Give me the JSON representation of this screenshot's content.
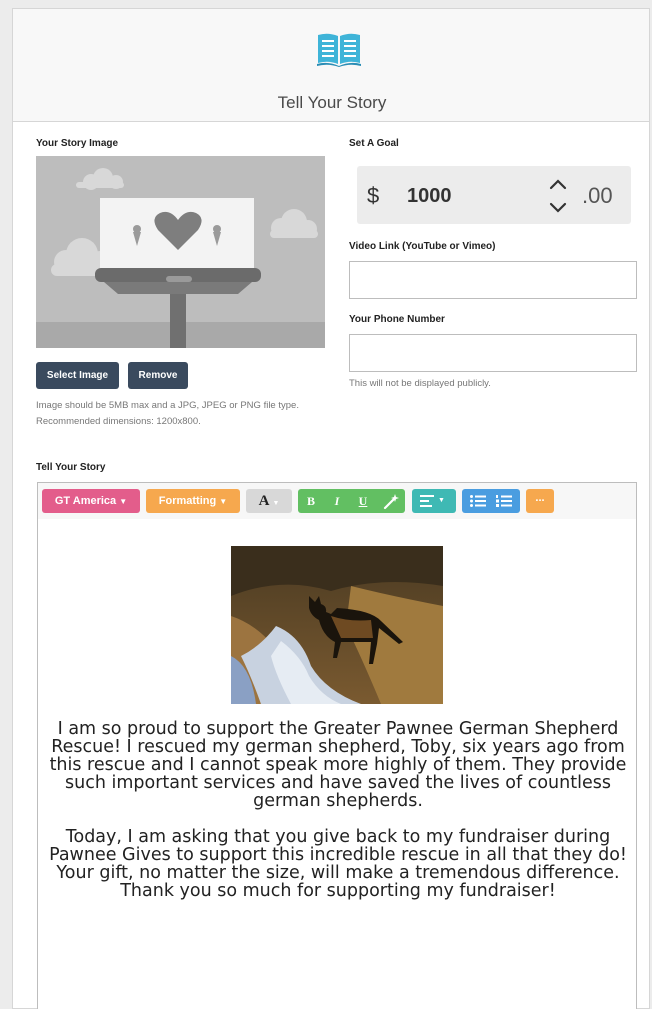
{
  "header": {
    "title": "Tell Your Story",
    "icon": "open-book-icon",
    "icon_color": "#3fb4d8"
  },
  "story_image": {
    "label": "Your Story Image",
    "select_label": "Select Image",
    "remove_label": "Remove",
    "help_line1": "Image should be 5MB max and a JPG, JPEG or PNG file type.",
    "help_line2": "Recommended dimensions: 1200x800."
  },
  "goal": {
    "label": "Set A Goal",
    "currency": "$",
    "value": "1000",
    "cents": ".00"
  },
  "video": {
    "label": "Video Link (YouTube or Vimeo)",
    "value": "",
    "placeholder": ""
  },
  "phone": {
    "label": "Your Phone Number",
    "value": "",
    "placeholder": "",
    "help": "This will not be displayed publicly."
  },
  "editor": {
    "label": "Tell Your Story",
    "toolbar": {
      "font": "GT America",
      "formatting": "Formatting",
      "color": "A",
      "bold": "B",
      "italic": "I",
      "underline": "U",
      "more": "...",
      "colors": {
        "font": "#e35d8b",
        "formatting": "#f6a84e",
        "style": "#62bf62",
        "align": "#3fb9b4",
        "list": "#4a9de0",
        "more": "#f6a84e"
      }
    },
    "paragraph1": "I am so proud to support the Greater Pawnee German Shepherd Rescue! I rescued my german shepherd, Toby, six years ago from this rescue and I cannot speak more highly of them. They provide such important services and have saved the lives of countless german shepherds.",
    "paragraph2": "Today, I am asking that you give back to my fundraiser during Pawnee Gives to support this incredible rescue in all that they do! Your gift, no matter the size, will make a tremendous difference. Thank you so much for supporting my fundraiser!"
  }
}
